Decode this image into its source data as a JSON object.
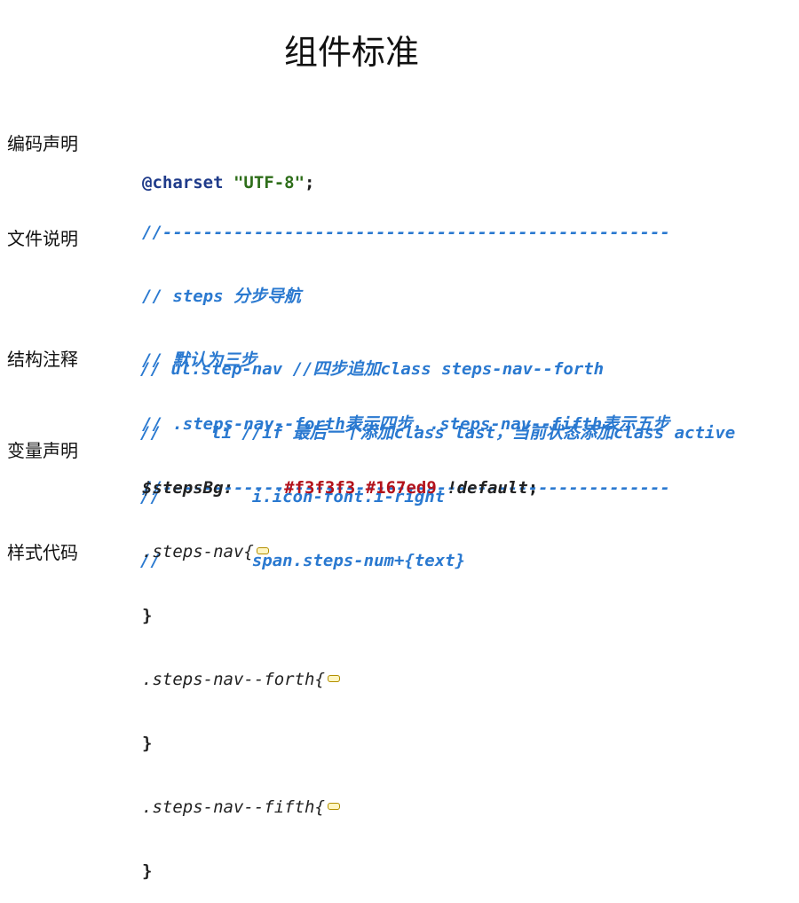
{
  "page": {
    "title": "组件标准"
  },
  "sections": {
    "encoding": {
      "label": "编码声明",
      "at": "@charset",
      "value": "\"UTF-8\"",
      "semicolon": ";"
    },
    "file": {
      "label": "文件说明",
      "lines": [
        "//--------------------------------------------------",
        "// steps 分步导航",
        "// 默认为三步",
        "// .steps-nav--forth表示四步，.steps-nav--fifth表示五步",
        "//--------------------------------------------------"
      ]
    },
    "structure": {
      "label": "结构注释",
      "lines": [
        "// ul.step-nav //四步追加class steps-nav--forth",
        "//     li //if 最后一个添加class last，当前状态添加class active",
        "//         i.icon-font.i-right",
        "//         span.steps-num+{text}"
      ]
    },
    "variables": {
      "label": "变量声明",
      "name": "$stepsBg:",
      "color1": "#f3f3f3",
      "color2": "#167ed9",
      "flag": "!default",
      "semicolon": ";"
    },
    "style": {
      "label": "样式代码",
      "blocks": [
        {
          "selector": ".steps-nav{",
          "close": "}"
        },
        {
          "selector": ".steps-nav--forth{",
          "close": "}"
        },
        {
          "selector": ".steps-nav--fifth{",
          "close": "}"
        }
      ]
    }
  },
  "colors": {
    "comment": "#2a79d0",
    "keyword": "#1f3b8a",
    "string": "#2e6e1a",
    "hex_value": "#b3121b",
    "fold_marker": "#b38f00"
  },
  "icons": {
    "fold": "folded-code-icon"
  }
}
